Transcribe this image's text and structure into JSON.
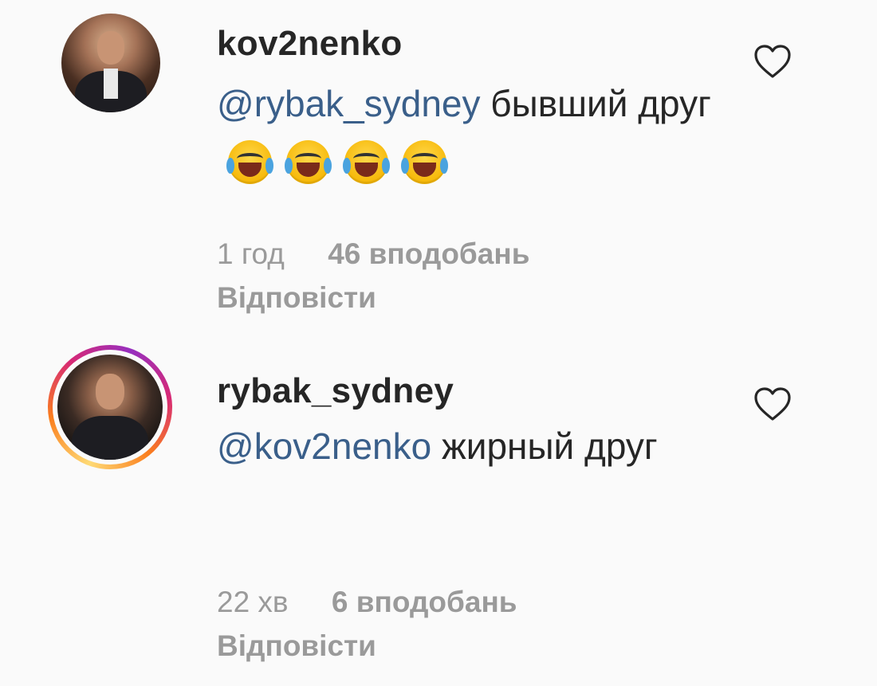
{
  "comments": [
    {
      "username": "kov2nenko",
      "mention": "@rybak_sydney",
      "text": "бывший друг",
      "emoji_count": 4,
      "time": "1 год",
      "likes": "46 вподобань",
      "reply_label": "Відповісти"
    },
    {
      "username": "rybak_sydney",
      "mention": "@kov2nenko",
      "text": "жирный друг",
      "time": "22 хв",
      "likes": "6 вподобань",
      "reply_label": "Відповісти"
    }
  ],
  "icons": {
    "emoji": "face-with-tears-of-joy-icon",
    "like": "heart-outline-icon"
  },
  "colors": {
    "mention": "#3a5f8a",
    "meta": "#9a9a9a",
    "text": "#262626"
  }
}
